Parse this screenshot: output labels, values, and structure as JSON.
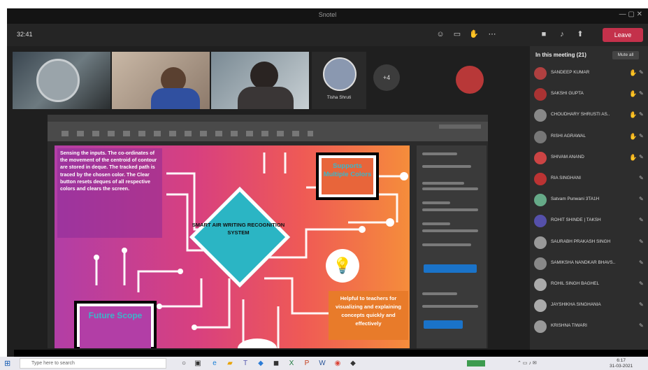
{
  "window": {
    "title": "Snotel"
  },
  "meeting_bar": {
    "timer": "32:41",
    "leave_label": "Leave"
  },
  "participants": {
    "tile_name": "Tisha Shruti",
    "overflow_count": "+4"
  },
  "slide": {
    "intro_text": "Sensing the inputs. The co-ordinates of the movement of the centroid of contour are stored in deque. The tracked path is traced by the chosen color. The Clear button resets deques of all respective colors and clears the screen.",
    "top_right_box": "Supports Multiple Colors",
    "center_title": "SMART AIR WRITING RECOGNITION SYSTEM",
    "helpful_box": "Helpful to teachers for visualizing and explaining concepts quickly and effectively",
    "bottom_left_box": "Future Scope"
  },
  "sidebar": {
    "header": "In this meeting (21)",
    "button": "Mute all",
    "people": [
      {
        "name": "SANDEEP KUMAR",
        "hand": true,
        "color": "#b04040"
      },
      {
        "name": "SAKSHI GUPTA",
        "hand": true,
        "color": "#a33"
      },
      {
        "name": "CHOUDHARY SHRUSTI AS..",
        "hand": true,
        "color": "#888"
      },
      {
        "name": "RISHI AGRAWAL",
        "hand": true,
        "color": "#777"
      },
      {
        "name": "SHIVAM ANAND",
        "hand": true,
        "color": "#c44"
      },
      {
        "name": "RIA SINGHANI",
        "hand": false,
        "color": "#b33"
      },
      {
        "name": "Satvam Punwani 3TA1H",
        "hand": false,
        "color": "#6a8"
      },
      {
        "name": "ROHIT SHINDE | TAKSH",
        "hand": false,
        "color": "#5550aa"
      },
      {
        "name": "SAURABH PRAKASH SINGH",
        "hand": false,
        "color": "#999"
      },
      {
        "name": "SAMIKSHA NANDKAR BHAVS..",
        "hand": false,
        "color": "#888"
      },
      {
        "name": "ROHIL SINGH BAGHEL",
        "hand": false,
        "color": "#aaa"
      },
      {
        "name": "JAYSHIKHA SINGHANIA",
        "hand": false,
        "color": "#aaa"
      },
      {
        "name": "KRISHNA TIWARI",
        "hand": false,
        "color": "#999"
      }
    ]
  },
  "taskbar": {
    "search_placeholder": "Type here to search",
    "time": "6:17",
    "date": "31-03-2021"
  }
}
